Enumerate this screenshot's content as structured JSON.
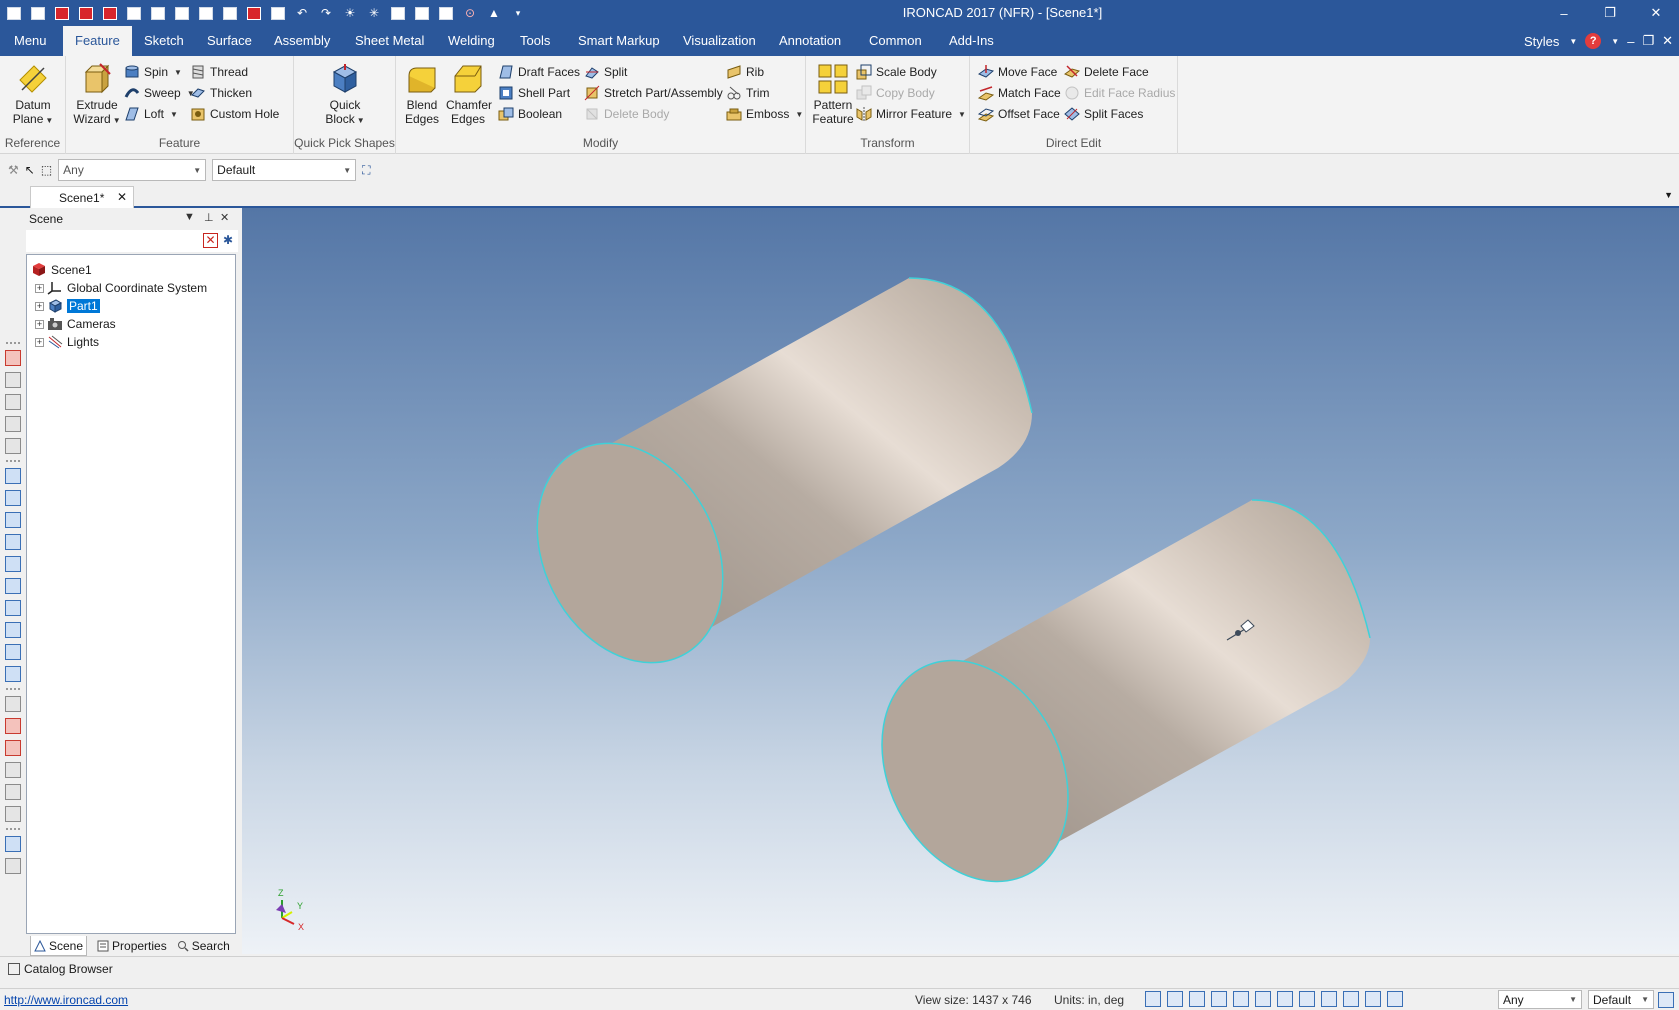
{
  "app": {
    "title": "IRONCAD 2017 (NFR) - [Scene1*]"
  },
  "window_controls": [
    "–",
    "❐",
    "✕"
  ],
  "ribbon_tabs": [
    "Menu",
    "Feature",
    "Sketch",
    "Surface",
    "Assembly",
    "Sheet Metal",
    "Welding",
    "Tools",
    "Smart Markup",
    "Visualization",
    "Annotation",
    "Common",
    "Add-Ins"
  ],
  "active_tab": "Feature",
  "ribbon_right": {
    "styles": "Styles",
    "help": "?"
  },
  "ribbon": {
    "reference": {
      "label": "Reference",
      "datum_plane": "Datum Plane"
    },
    "feature": {
      "label": "Feature",
      "extrude_wizard": "Extrude Wizard",
      "spin": "Spin",
      "sweep": "Sweep",
      "loft": "Loft",
      "thread": "Thread",
      "thicken": "Thicken",
      "custom_hole": "Custom Hole"
    },
    "quick_pick": {
      "label": "Quick Pick Shapes",
      "quick_block": "Quick Block"
    },
    "modify": {
      "label": "Modify",
      "blend_edges": "Blend Edges",
      "chamfer_edges": "Chamfer Edges",
      "draft_faces": "Draft Faces",
      "shell_part": "Shell Part",
      "boolean": "Boolean",
      "split": "Split",
      "stretch": "Stretch Part/Assembly",
      "delete_body": "Delete Body",
      "rib": "Rib",
      "trim": "Trim",
      "emboss": "Emboss"
    },
    "transform": {
      "label": "Transform",
      "pattern_feature": "Pattern Feature",
      "scale_body": "Scale Body",
      "copy_body": "Copy Body",
      "mirror_feature": "Mirror Feature"
    },
    "direct_edit": {
      "label": "Direct Edit",
      "move_face": "Move Face",
      "match_face": "Match Face",
      "offset_face": "Offset Face",
      "delete_face": "Delete Face",
      "edit_face_radius": "Edit Face Radius",
      "split_faces": "Split Faces"
    }
  },
  "selection_bar": {
    "filter": "Any",
    "style": "Default"
  },
  "doc_tab": "Scene1*",
  "scene_panel": {
    "title": "Scene",
    "tree": [
      {
        "label": "Scene1"
      },
      {
        "label": "Global Coordinate System"
      },
      {
        "label": "Part1"
      },
      {
        "label": "Cameras"
      },
      {
        "label": "Lights"
      }
    ],
    "tabs": [
      "Scene",
      "Properties",
      "Search"
    ]
  },
  "axis_labels": {
    "z": "Z",
    "y": "Y",
    "x": "X"
  },
  "catalog_browser": "Catalog Browser",
  "status": {
    "url": "http://www.ironcad.com",
    "view_size": "View size: 1437 x  746",
    "units": "Units: in, deg",
    "filter": "Any",
    "style": "Default"
  },
  "colors": {
    "title_bar": "#2b579a",
    "cylinder": "#b9aea4",
    "edge_highlight": "#3fd1d8",
    "selected": "#0078d7"
  }
}
